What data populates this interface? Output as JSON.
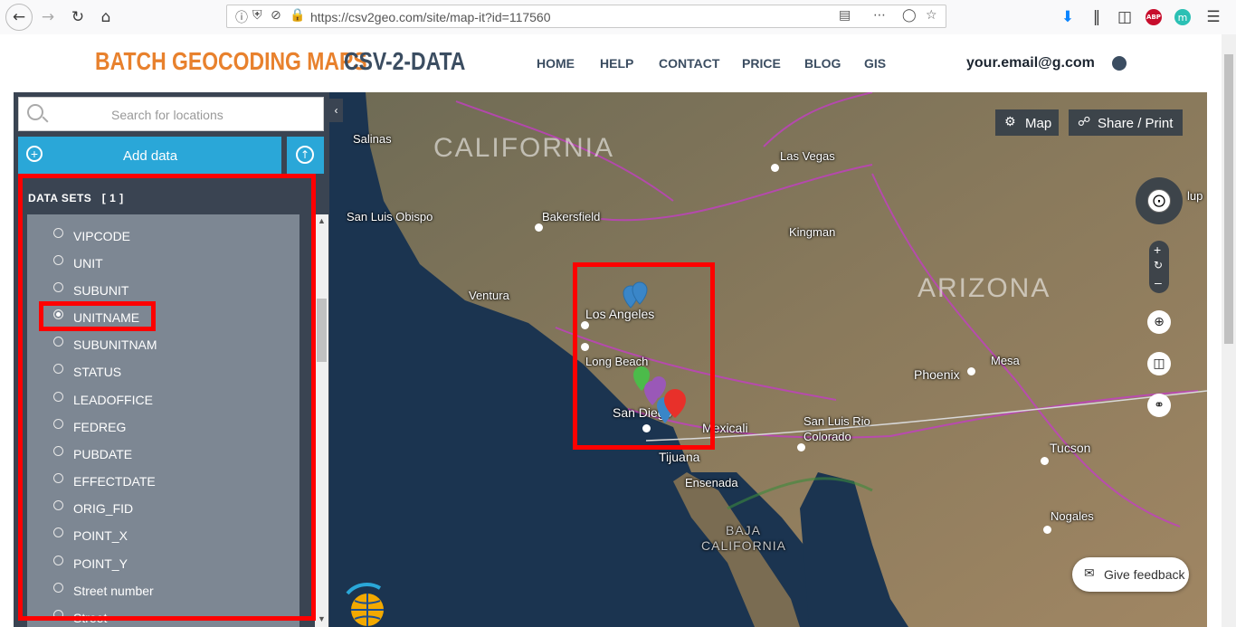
{
  "browser": {
    "url": "https://csv2geo.com/site/map-it?id=117560",
    "abp_badge": "ABP",
    "ext_badge": "m"
  },
  "header": {
    "brand_primary": "BATCH GEOCODING MAPS",
    "brand_secondary": "CSV-2-DATA",
    "nav": [
      "HOME",
      "HELP",
      "CONTACT",
      "PRICE",
      "BLOG",
      "GIS"
    ],
    "user_email": "your.email@g.com"
  },
  "sidebar": {
    "search_placeholder": "Search for locations",
    "add_data_label": "Add data",
    "datasets_label": "DATA SETS",
    "datasets_count": "[ 1 ]",
    "fields": [
      "VIPCODE",
      "UNIT",
      "SUBUNIT",
      "UNITNAME",
      "SUBUNITNAM",
      "STATUS",
      "LEADOFFICE",
      "FEDREG",
      "PUBDATE",
      "EFFECTDATE",
      "ORIG_FID",
      "POINT_X",
      "POINT_Y",
      "Street number",
      "Street"
    ],
    "selected_field": "UNITNAME"
  },
  "map": {
    "map_button": "Map",
    "share_button": "Share / Print",
    "feedback_label": "Give feedback",
    "labels": {
      "california": "CALIFORNIA",
      "arizona": "ARIZONA",
      "baja": "BAJA",
      "baja2": "CALIFORNIA",
      "salinas": "Salinas",
      "las_vegas": "Las Vegas",
      "bakersfield": "Bakersfield",
      "san_luis_obispo": "San Luis Obispo",
      "kingman": "Kingman",
      "ventura": "Ventura",
      "los_angeles": "Los Angeles",
      "long_beach": "Long Beach",
      "san_diego": "San Diego",
      "mexicali": "Mexicali",
      "san_luis_rio": "San Luis Rio",
      "colorado": "Colorado",
      "tijuana": "Tijuana",
      "ensenada": "Ensenada",
      "phoenix": "Phoenix",
      "mesa": "Mesa",
      "tucson": "Tucson",
      "nogales": "Nogales",
      "flagstaff_partial": "lup"
    },
    "colors": {
      "pin_blue": "#3a86c8",
      "pin_green": "#4cbb4a",
      "pin_purple": "#9a58b8",
      "pin_red": "#e8302a",
      "highlight": "#ff0000"
    }
  }
}
